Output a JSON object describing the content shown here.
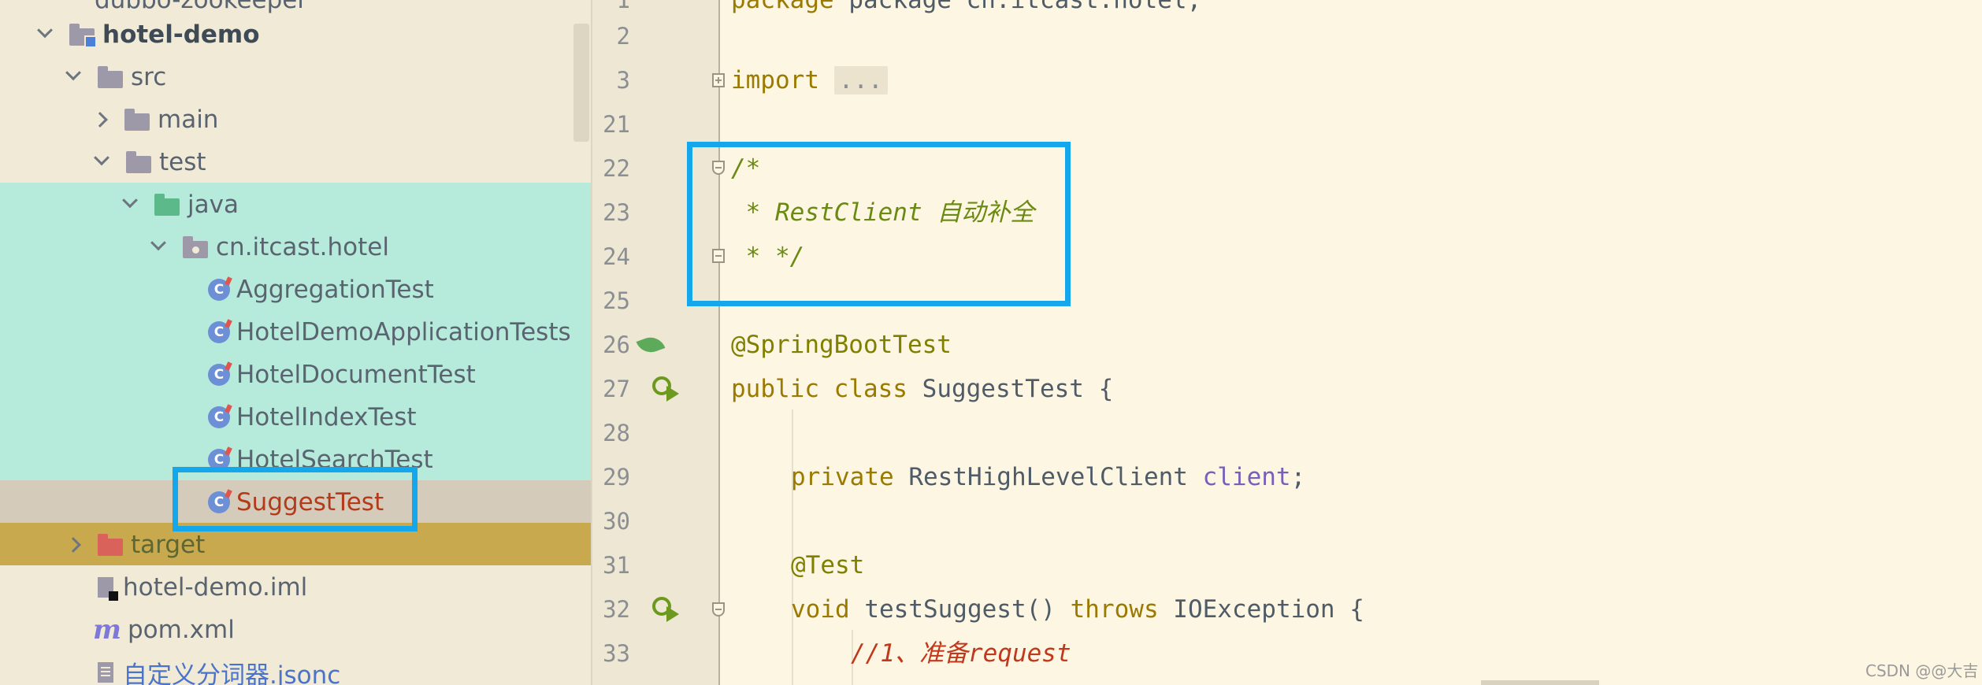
{
  "project_tree": {
    "items": [
      {
        "label": "dubbo-zookeeper",
        "kind": "module"
      },
      {
        "label": "hotel-demo",
        "kind": "module",
        "expanded": true
      },
      {
        "label": "src",
        "kind": "folder",
        "expanded": true
      },
      {
        "label": "main",
        "kind": "folder",
        "expanded": false
      },
      {
        "label": "test",
        "kind": "folder",
        "expanded": true
      },
      {
        "label": "java",
        "kind": "test-source-root",
        "expanded": true
      },
      {
        "label": "cn.itcast.hotel",
        "kind": "package",
        "expanded": true
      },
      {
        "label": "AggregationTest",
        "kind": "java-class"
      },
      {
        "label": "HotelDemoApplicationTests",
        "kind": "java-class"
      },
      {
        "label": "HotelDocumentTest",
        "kind": "java-class"
      },
      {
        "label": "HotelIndexTest",
        "kind": "java-class"
      },
      {
        "label": "HotelSearchTest",
        "kind": "java-class"
      },
      {
        "label": "SuggestTest",
        "kind": "java-class",
        "selected": true
      },
      {
        "label": "target",
        "kind": "excluded-folder",
        "expanded": false
      },
      {
        "label": "hotel-demo.iml",
        "kind": "iml-file"
      },
      {
        "label": "pom.xml",
        "kind": "maven-file"
      },
      {
        "label": "自定义分词器.jsonc",
        "kind": "jsonc-file"
      }
    ],
    "icons": {
      "expanded": "chevron-down-icon",
      "collapsed": "chevron-right-icon",
      "folder": "folder-icon",
      "package": "package-icon",
      "class": "java-class-icon",
      "maven": "maven-m-icon"
    }
  },
  "editor": {
    "lines": [
      {
        "num": "1",
        "text": "package cn.itcast.hotel;"
      },
      {
        "num": "2",
        "text": ""
      },
      {
        "num": "3",
        "kw": "import",
        "collapsed": "..."
      },
      {
        "num": "21",
        "text": ""
      },
      {
        "num": "22",
        "comment": "/*"
      },
      {
        "num": "23",
        "comment": " * RestClient 自动补全"
      },
      {
        "num": "24",
        "comment": " * */"
      },
      {
        "num": "25",
        "text": ""
      },
      {
        "num": "26",
        "annotation": "@SpringBootTest"
      },
      {
        "num": "27",
        "kw1": "public",
        "kw2": "class",
        "rest": "SuggestTest {"
      },
      {
        "num": "28",
        "text": ""
      },
      {
        "num": "29",
        "kw": "private",
        "type": "RestHighLevelClient",
        "field": "client",
        "end": ";"
      },
      {
        "num": "30",
        "text": ""
      },
      {
        "num": "31",
        "annotation": "@Test"
      },
      {
        "num": "32",
        "kw": "void",
        "method": "testSuggest()",
        "kw2": "throws",
        "rest": "IOException {"
      },
      {
        "num": "33",
        "line_comment": "//1、准备request"
      }
    ],
    "gutter_icons": {
      "line26": "spring-bean-icon",
      "line27": "run-test-icon",
      "line32": "run-test-icon"
    }
  },
  "colors": {
    "highlight_box": "#14a7ec",
    "selection_teal": "#b6eadb",
    "excluded_folder_band": "#c9a94d",
    "keyword": "#9a7a00",
    "doc_comment": "#6b8a12",
    "line_comment": "#c0391d",
    "field": "#7561b8"
  },
  "watermark": "CSDN @@大吉"
}
